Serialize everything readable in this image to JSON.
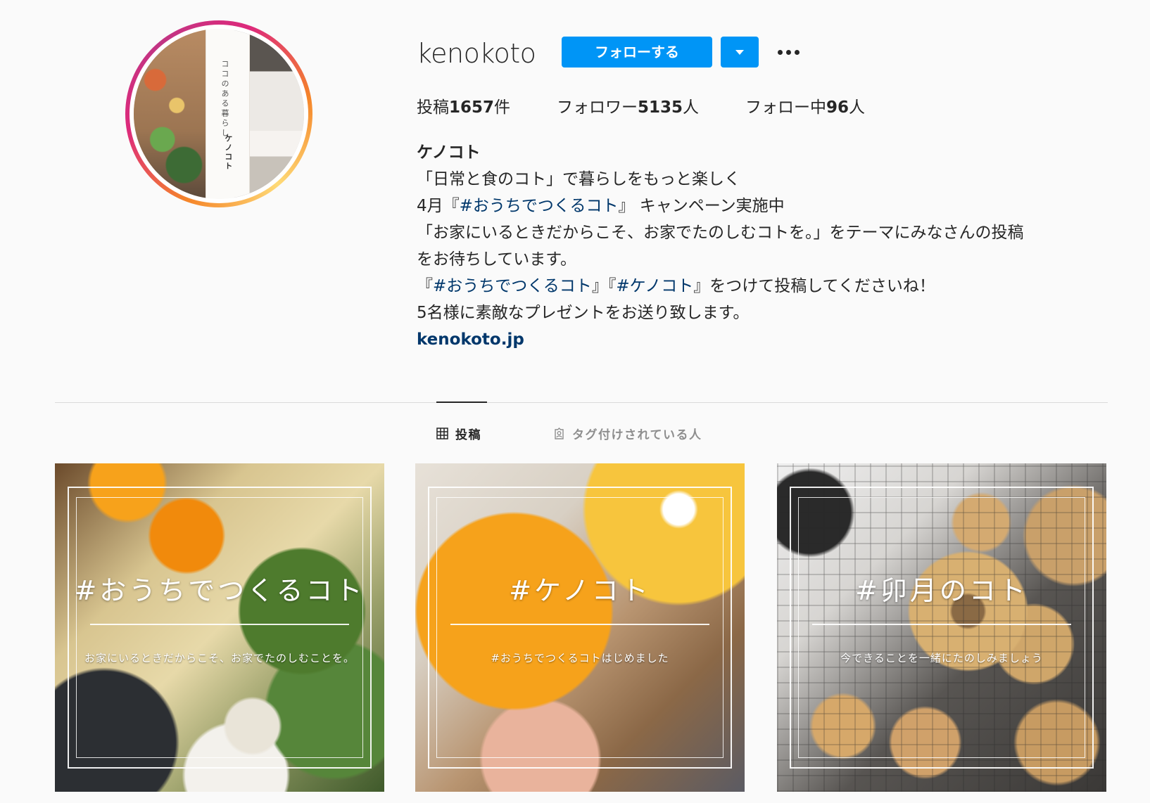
{
  "profile": {
    "username": "kenokoto",
    "follow_label": "フォローする",
    "avatar_text_vertical": "ココのある暮らし",
    "avatar_text_name": "ケノコト"
  },
  "stats": {
    "posts_label": "投稿",
    "posts_count": "1657",
    "posts_unit": "件",
    "followers_label": "フォロワー",
    "followers_count": "5135",
    "followers_unit": "人",
    "following_label": "フォロー中",
    "following_count": "96",
    "following_unit": "人"
  },
  "bio": {
    "name": "ケノコト",
    "line1": "「日常と食のコト」で暮らしをもっと楽しく",
    "line2_prefix": "4月『",
    "line2_tag": "#おうちでつくるコト",
    "line2_suffix": "』 キャンペーン実施中",
    "line3": "「お家にいるときだからこそ、お家でたのしむコトを。」をテーマにみなさんの投稿",
    "line4": "をお待ちしています。",
    "line5_open": "『",
    "line5_tag1": "#おうちでつくるコト",
    "line5_mid": "』『",
    "line5_tag2": "#ケノコト",
    "line5_suffix": "』をつけて投稿してくださいね！",
    "line6": "5名様に素敵なプレゼントをお送り致します。",
    "link": "kenokoto.jp"
  },
  "tabs": {
    "posts": "投稿",
    "tagged": "タグ付けされている人"
  },
  "posts": [
    {
      "title": "#おうちでつくるコト",
      "subtitle": "お家にいるときだからこそ、お家でたのしむことを。"
    },
    {
      "title": "#ケノコト",
      "subtitle": "#おうちでつくるコトはじめました"
    },
    {
      "title": "#卯月のコト",
      "subtitle": "今できることを一緒にたのしみましょう"
    }
  ],
  "colors": {
    "accent": "#0095f6",
    "link": "#00376b",
    "text": "#262626",
    "muted": "#8e8e8e"
  }
}
